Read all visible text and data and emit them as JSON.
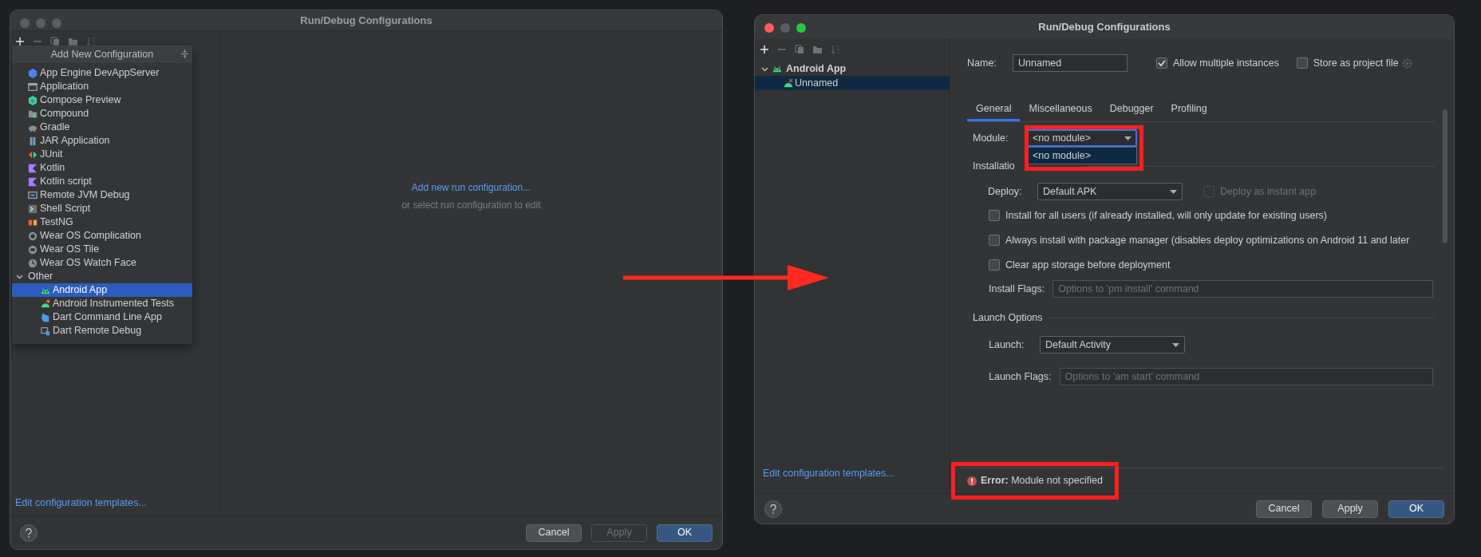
{
  "left_window": {
    "title": "Run/Debug Configurations",
    "add_menu": {
      "title": "Add New Configuration",
      "items": [
        {
          "label": "App Engine DevAppServer",
          "selected": false
        },
        {
          "label": "Application",
          "selected": false
        },
        {
          "label": "Compose Preview",
          "selected": false
        },
        {
          "label": "Compound",
          "selected": false
        },
        {
          "label": "Gradle",
          "selected": false
        },
        {
          "label": "JAR Application",
          "selected": false
        },
        {
          "label": "JUnit",
          "selected": false
        },
        {
          "label": "Kotlin",
          "selected": false
        },
        {
          "label": "Kotlin script",
          "selected": false
        },
        {
          "label": "Remote JVM Debug",
          "selected": false
        },
        {
          "label": "Shell Script",
          "selected": false
        },
        {
          "label": "TestNG",
          "selected": false
        },
        {
          "label": "Wear OS Complication",
          "selected": false
        },
        {
          "label": "Wear OS Tile",
          "selected": false
        },
        {
          "label": "Wear OS Watch Face",
          "selected": false
        }
      ],
      "group": {
        "label": "Other",
        "expanded": true,
        "children": [
          {
            "label": "Android App",
            "selected": true
          },
          {
            "label": "Android Instrumented Tests",
            "selected": false
          },
          {
            "label": "Dart Command Line App",
            "selected": false
          },
          {
            "label": "Dart Remote Debug",
            "selected": false
          }
        ]
      }
    },
    "empty_link": "Add new run configuration...",
    "empty_hint": "or select run configuration to edit",
    "templates_link": "Edit configuration templates...",
    "buttons": [
      {
        "label": "Cancel",
        "kind": "normal"
      },
      {
        "label": "Apply",
        "kind": "disabled"
      },
      {
        "label": "OK",
        "kind": "default"
      }
    ]
  },
  "right_window": {
    "title": "Run/Debug Configurations",
    "tree": [
      {
        "label": "Android App",
        "expanded": true,
        "selected": false,
        "children": [
          {
            "label": "Unnamed",
            "selected": true
          }
        ]
      }
    ],
    "templates_link": "Edit configuration templates...",
    "name": {
      "label": "Name:",
      "value": "Unnamed"
    },
    "allow_multiple": {
      "label": "Allow multiple instances",
      "checked": true
    },
    "store_as_file": {
      "label": "Store as project file",
      "checked": false
    },
    "tabs": [
      {
        "label": "General",
        "selected": true
      },
      {
        "label": "Miscellaneous",
        "selected": false
      },
      {
        "label": "Debugger",
        "selected": false
      },
      {
        "label": "Profiling",
        "selected": false
      }
    ],
    "module": {
      "label": "Module:",
      "value": "<no module>",
      "expanded": true,
      "options": [
        "<no module>"
      ]
    },
    "installation_section": "Installatio",
    "deploy": {
      "label": "Deploy:",
      "value": "Default APK"
    },
    "instant_app": {
      "label": "Deploy as instant app",
      "checked": false,
      "disabled": true
    },
    "install_options": [
      {
        "label": "Install for all users (if already installed, will only update for existing users)",
        "checked": false
      },
      {
        "label": "Always install with package manager (disables deploy optimizations on Android 11 and later",
        "checked": false
      },
      {
        "label": "Clear app storage before deployment",
        "checked": false
      }
    ],
    "install_flags": {
      "label": "Install Flags:",
      "placeholder": "Options to 'pm install' command"
    },
    "launch_section": "Launch Options",
    "launch": {
      "label": "Launch:",
      "value": "Default Activity"
    },
    "launch_flags": {
      "label": "Launch Flags:",
      "placeholder": "Options to 'am start' command"
    },
    "error": "**Error:** Module not specified",
    "buttons": [
      {
        "label": "Cancel",
        "kind": "normal"
      },
      {
        "label": "Apply",
        "kind": "normal"
      },
      {
        "label": "OK",
        "kind": "default"
      }
    ]
  }
}
